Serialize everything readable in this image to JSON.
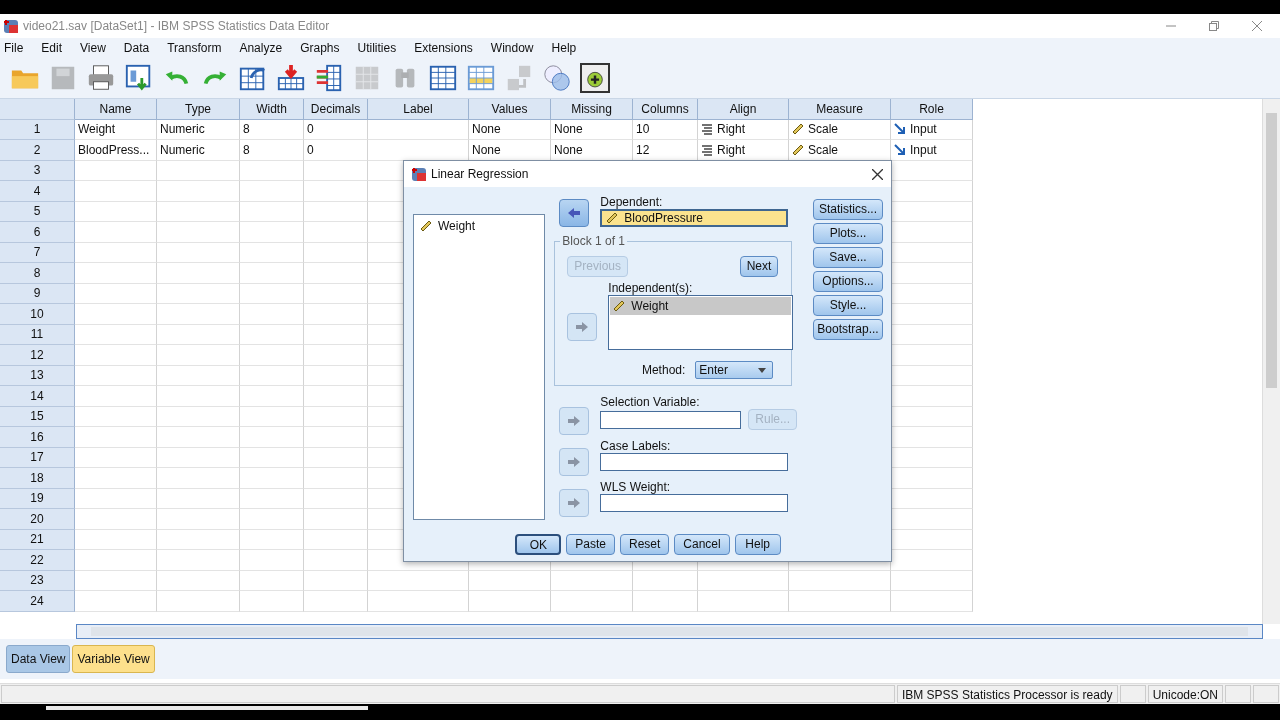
{
  "window": {
    "title": "video21.sav [DataSet1] - IBM SPSS Statistics Data Editor"
  },
  "menu": [
    "File",
    "Edit",
    "View",
    "Data",
    "Transform",
    "Analyze",
    "Graphs",
    "Utilities",
    "Extensions",
    "Window",
    "Help"
  ],
  "toolbar": [
    {
      "kind": "folder",
      "disabled": false
    },
    {
      "kind": "save",
      "disabled": true
    },
    {
      "kind": "print",
      "disabled": false
    },
    {
      "kind": "recall",
      "disabled": false
    },
    {
      "kind": "undo",
      "disabled": false
    },
    {
      "kind": "redo",
      "disabled": false
    },
    {
      "kind": "goto",
      "disabled": false
    },
    {
      "kind": "insert-case",
      "disabled": false
    },
    {
      "kind": "insert-variable",
      "disabled": false
    },
    {
      "kind": "split",
      "disabled": true
    },
    {
      "kind": "find",
      "disabled": true
    },
    {
      "kind": "grid",
      "disabled": false
    },
    {
      "kind": "table-highlight",
      "disabled": false
    },
    {
      "kind": "labels",
      "disabled": true
    },
    {
      "kind": "circles",
      "disabled": false
    },
    {
      "kind": "add",
      "disabled": false
    }
  ],
  "table": {
    "columns": [
      "Name",
      "Type",
      "Width",
      "Decimals",
      "Label",
      "Values",
      "Missing",
      "Columns",
      "Align",
      "Measure",
      "Role"
    ],
    "rows": [
      {
        "number": "1",
        "cells": [
          "Weight",
          "Numeric",
          "8",
          "0",
          "",
          "None",
          "None",
          "10",
          "Right",
          "Scale",
          "Input"
        ]
      },
      {
        "number": "2",
        "cells": [
          "BloodPress...",
          "Numeric",
          "8",
          "0",
          "",
          "None",
          "None",
          "12",
          "Right",
          "Scale",
          "Input"
        ]
      },
      {
        "number": "3"
      },
      {
        "number": "4"
      },
      {
        "number": "5"
      },
      {
        "number": "6"
      },
      {
        "number": "7"
      },
      {
        "number": "8"
      },
      {
        "number": "9"
      },
      {
        "number": "10"
      },
      {
        "number": "11"
      },
      {
        "number": "12"
      },
      {
        "number": "13"
      },
      {
        "number": "14"
      },
      {
        "number": "15"
      },
      {
        "number": "16"
      },
      {
        "number": "17"
      },
      {
        "number": "18"
      },
      {
        "number": "19"
      },
      {
        "number": "20"
      },
      {
        "number": "21"
      },
      {
        "number": "22"
      },
      {
        "number": "23"
      },
      {
        "number": "24"
      }
    ]
  },
  "dialog": {
    "title": "Linear Regression",
    "source_list": [
      "Weight"
    ],
    "dependent": {
      "label": "Dependent:",
      "value": "BloodPressure",
      "move_button": {
        "kind": "remove",
        "disabled": false
      }
    },
    "block": {
      "label": "Block 1 of 1",
      "previous": {
        "label": "Previous",
        "disabled": true
      },
      "next": {
        "label": "Next",
        "disabled": false
      },
      "independents": {
        "label": "Independent(s):",
        "items": [
          {
            "name": "Weight",
            "selected": true
          }
        ],
        "move_button": {
          "kind": "add",
          "disabled": true
        }
      },
      "method": {
        "label": "Method:",
        "value": "Enter"
      }
    },
    "selection_variable": {
      "label": "Selection Variable:",
      "rule": {
        "label": "Rule...",
        "disabled": true
      },
      "move_button": {
        "kind": "add",
        "disabled": true
      }
    },
    "case_labels": {
      "label": "Case Labels:",
      "move_button": {
        "kind": "add",
        "disabled": true
      }
    },
    "wls_weight": {
      "label": "WLS Weight:",
      "move_button": {
        "kind": "add",
        "disabled": true
      }
    },
    "side_buttons": [
      "Statistics...",
      "Plots...",
      "Save...",
      "Options...",
      "Style...",
      "Bootstrap..."
    ],
    "buttons": [
      {
        "label": "OK",
        "default": true
      },
      {
        "label": "Paste",
        "default": false
      },
      {
        "label": "Reset",
        "default": false
      },
      {
        "label": "Cancel",
        "default": false
      },
      {
        "label": "Help",
        "default": false
      }
    ]
  },
  "tabs": [
    {
      "label": "Data View",
      "selected": false
    },
    {
      "label": "Variable View",
      "selected": true
    }
  ],
  "status_bar": [
    "IBM SPSS Statistics Processor is ready",
    "Unicode:ON"
  ]
}
